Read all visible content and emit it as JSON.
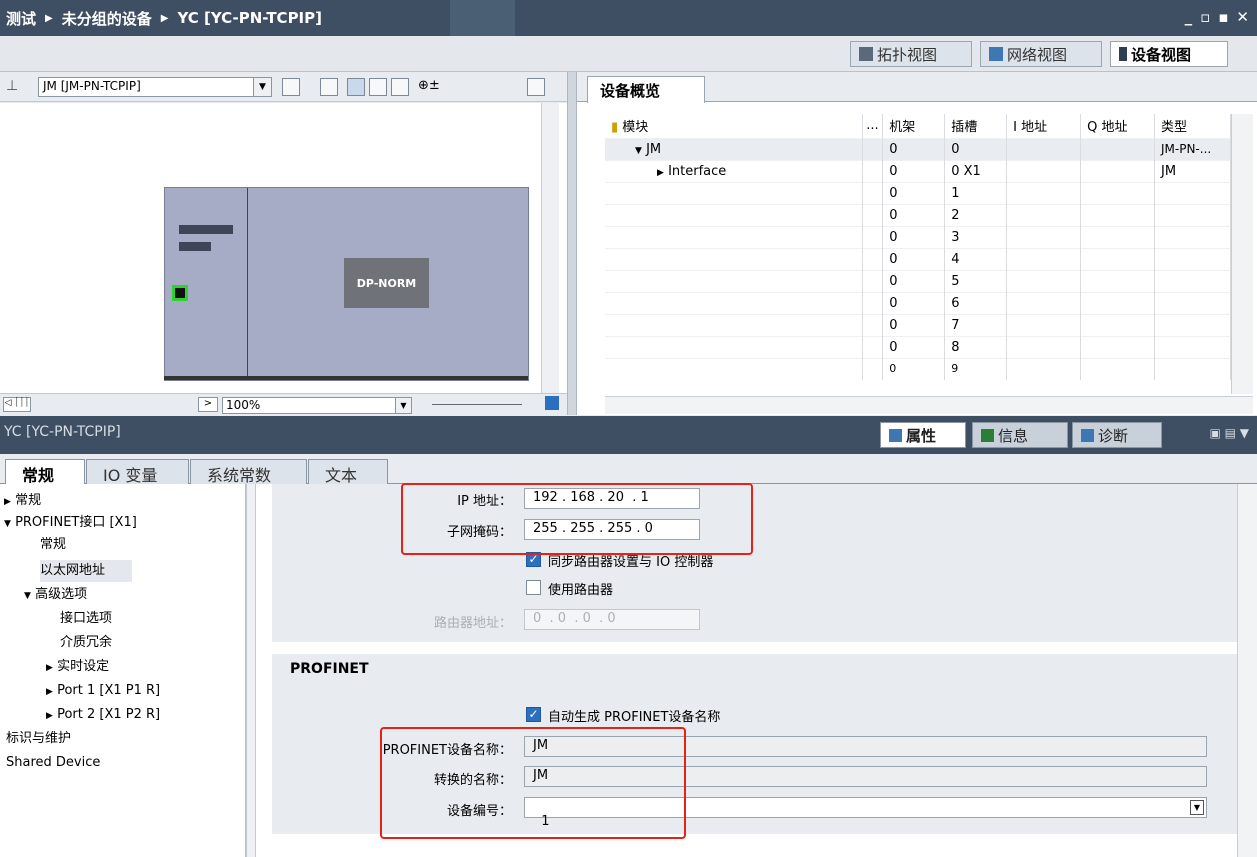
{
  "title": {
    "crumbs": [
      "测试",
      "未分组的设备",
      "YC [YC-PN-TCPIP]"
    ],
    "window_buttons": [
      "_",
      "▫",
      "▪",
      "✕"
    ]
  },
  "view_tabs": [
    "拓扑视图",
    "网络视图",
    "设备视图"
  ],
  "graphics": {
    "device_selector": "JM [JM-PN-TCPIP]",
    "module_label": "DP-NORM",
    "zoom": "100%"
  },
  "overview": {
    "tab": "设备概览",
    "columns": [
      "模块",
      "...",
      "机架",
      "插槽",
      "I 地址",
      "Q 地址",
      "类型"
    ],
    "rows": [
      {
        "module": "JM",
        "rack": "0",
        "slot": "0",
        "type": "JM-PN-..."
      },
      {
        "module": "Interface",
        "rack": "0",
        "slot": "0 X1",
        "type": "JM"
      },
      {
        "module": "",
        "rack": "0",
        "slot": "1",
        "type": ""
      },
      {
        "module": "",
        "rack": "0",
        "slot": "2",
        "type": ""
      },
      {
        "module": "",
        "rack": "0",
        "slot": "3",
        "type": ""
      },
      {
        "module": "",
        "rack": "0",
        "slot": "4",
        "type": ""
      },
      {
        "module": "",
        "rack": "0",
        "slot": "5",
        "type": ""
      },
      {
        "module": "",
        "rack": "0",
        "slot": "6",
        "type": ""
      },
      {
        "module": "",
        "rack": "0",
        "slot": "7",
        "type": ""
      },
      {
        "module": "",
        "rack": "0",
        "slot": "8",
        "type": ""
      },
      {
        "module": "",
        "rack": "0",
        "slot": "9",
        "type": ""
      }
    ]
  },
  "properties": {
    "title": "YC [YC-PN-TCPIP]",
    "tabs": [
      "属性",
      "信息",
      "诊断"
    ],
    "subtabs": [
      "常规",
      "IO 变量",
      "系统常数",
      "文本"
    ]
  },
  "nav": {
    "items": [
      "常规",
      "PROFINET接口 [X1]",
      "常规",
      "以太网地址",
      "高级选项",
      "接口选项",
      "介质冗余",
      "实时设定",
      "Port 1 [X1 P1 R]",
      "Port 2 [X1 P2 R]",
      "标识与维护",
      "Shared Device"
    ]
  },
  "form": {
    "ip_label": "IP 地址：",
    "ip_value": "192 . 168 . 20  . 1",
    "mask_label": "子网掩码：",
    "mask_value": "255 . 255 . 255 . 0",
    "sync_router_label": "同步路由器设置与 IO 控制器",
    "use_router_label": "使用路由器",
    "router_label": "路由器地址：",
    "router_value": "0  . 0  . 0  . 0",
    "section_title": "PROFINET",
    "auto_name_label": "自动生成 PROFINET设备名称",
    "device_name_label": "PROFINET设备名称：",
    "device_name_value": "JM",
    "converted_label": "转换的名称：",
    "converted_value": "JM",
    "device_number_label": "设备编号：",
    "device_number_value": "1"
  },
  "colors": {
    "accent": "#3e4f63",
    "highlight_box": "#e5221a"
  }
}
